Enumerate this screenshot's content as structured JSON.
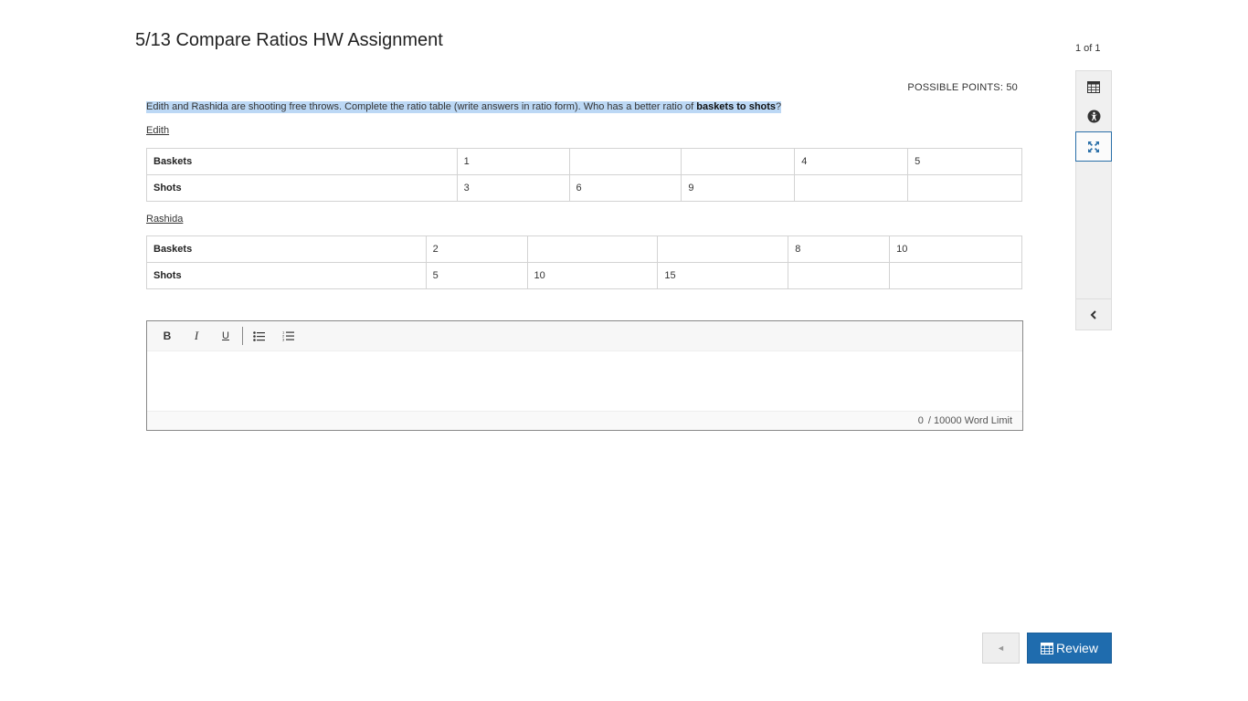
{
  "assignment": {
    "title": "5/13 Compare Ratios HW Assignment",
    "page_count": "1 of 1"
  },
  "question": {
    "points_label": "POSSIBLE POINTS: 50",
    "text_before": "Edith and Rashida are shooting free throws. Complete the ratio table (write answers in ratio form). Who has a better ratio of ",
    "text_bold": "baskets to shots",
    "text_after": "?"
  },
  "tables": [
    {
      "name": "Edith",
      "rows": [
        {
          "header": "Baskets",
          "cells": [
            "1",
            "",
            "",
            "4",
            "5"
          ]
        },
        {
          "header": "Shots",
          "cells": [
            "3",
            "6",
            "9",
            "",
            ""
          ]
        }
      ]
    },
    {
      "name": "Rashida",
      "rows": [
        {
          "header": "Baskets",
          "cells": [
            "2",
            "",
            "",
            "8",
            "10"
          ]
        },
        {
          "header": "Shots",
          "cells": [
            "5",
            "10",
            "15",
            "",
            ""
          ]
        }
      ]
    }
  ],
  "editor": {
    "toolbar": {
      "bold": "B",
      "italic": "I",
      "underline": "U"
    },
    "word_count": "0",
    "word_limit": "/ 10000 Word Limit"
  },
  "sidebar": {
    "icons": [
      "calendar-icon",
      "accessibility-icon",
      "fullscreen-icon",
      "chevron-left-icon"
    ]
  },
  "navigation": {
    "prev_label": "◄",
    "review_label": "Review"
  },
  "colors": {
    "primary": "#1f6cae",
    "highlight": "#bcd8f5",
    "active_border": "#2a6fa8"
  }
}
